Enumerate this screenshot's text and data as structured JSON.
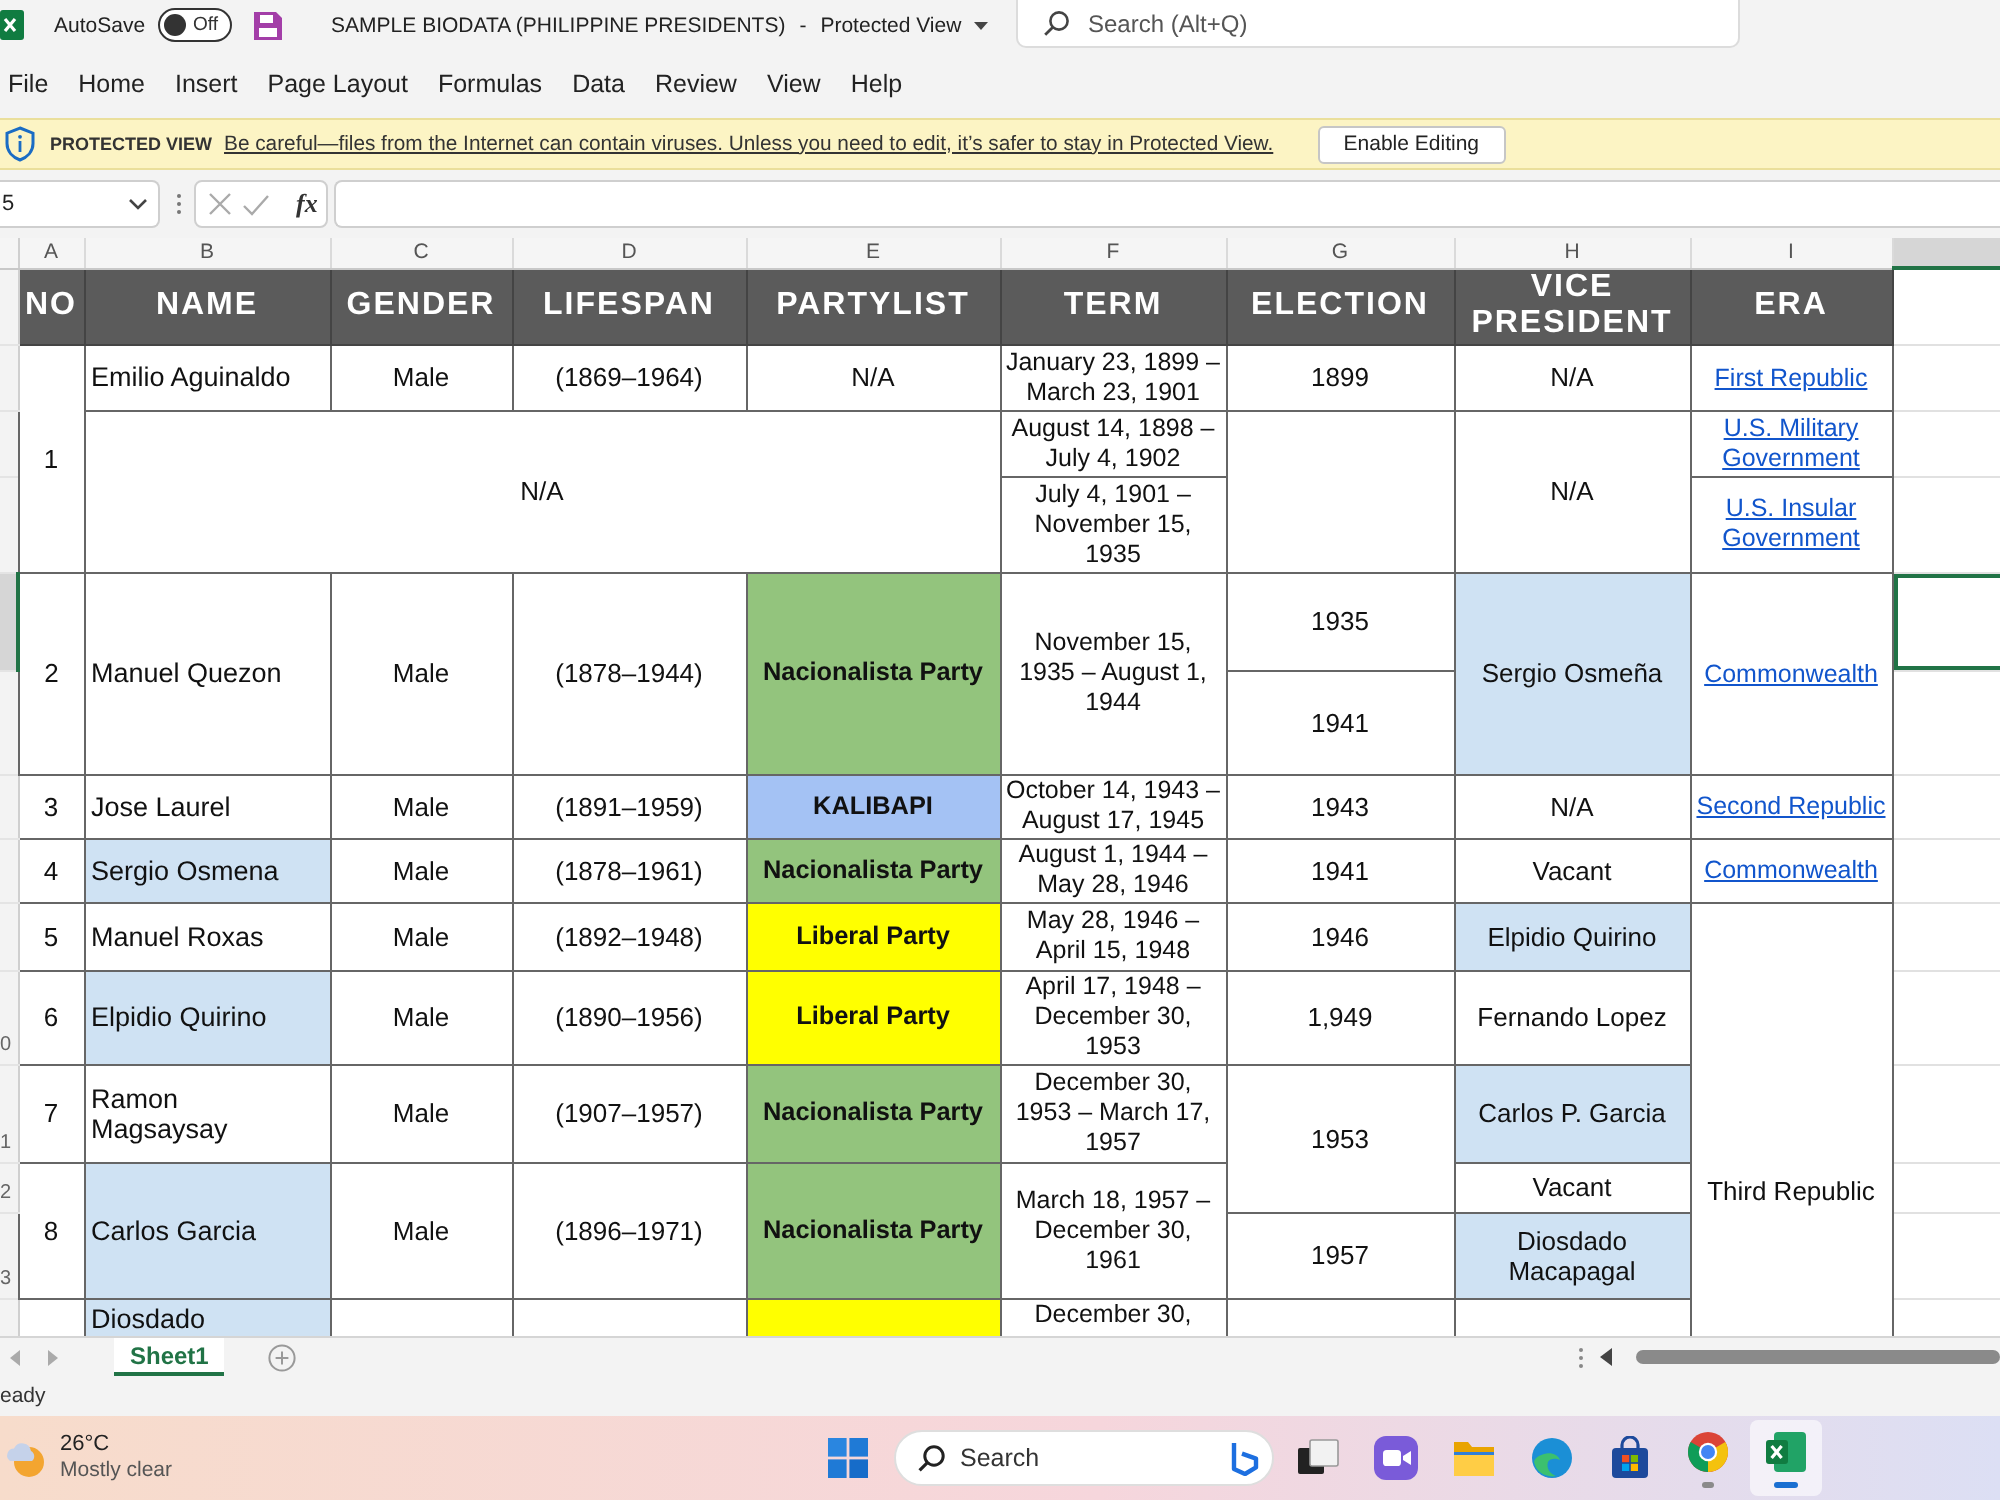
{
  "title_bar": {
    "autosave_label": "AutoSave",
    "autosave": {
      "on": false,
      "label": "Off"
    },
    "document_title": "SAMPLE BIODATA (PHILIPPINE PRESIDENTS)",
    "separator": "-",
    "view_mode": "Protected View",
    "search": {
      "placeholder": "Search (Alt+Q)"
    }
  },
  "menu": [
    {
      "label": "File",
      "selected": false
    },
    {
      "label": "Home",
      "selected": false
    },
    {
      "label": "Insert",
      "selected": false
    },
    {
      "label": "Page Layout",
      "selected": false
    },
    {
      "label": "Formulas",
      "selected": false
    },
    {
      "label": "Data",
      "selected": false
    },
    {
      "label": "Review",
      "selected": false
    },
    {
      "label": "View",
      "selected": false
    },
    {
      "label": "Help",
      "selected": false
    }
  ],
  "protected_view": {
    "title": "PROTECTED VIEW",
    "message": "Be careful—files from the Internet can contain viruses. Unless you need to edit, it’s safer to stay in Protected View.",
    "button": "Enable Editing"
  },
  "formula_bar": {
    "name_box": "5",
    "function_label": "fx"
  },
  "sheet": {
    "column_letters": [
      "A",
      "B",
      "C",
      "D",
      "E",
      "F",
      "G",
      "H",
      "I"
    ],
    "headers": [
      "NO",
      "NAME",
      "GENDER",
      "LIFESPAN",
      "PARTYLIST",
      "TERM",
      "ELECTION",
      "VICE PRESIDENT",
      "ERA"
    ],
    "rows": [
      {
        "selected": false,
        "cells": [
          {
            "kind": "text",
            "text": "1",
            "rowspan": 3
          },
          {
            "kind": "name",
            "text": "Emilio Aguinaldo"
          },
          {
            "kind": "text",
            "text": "Male"
          },
          {
            "kind": "text",
            "text": "(1869–1964)"
          },
          {
            "kind": "text",
            "text": "N/A"
          },
          {
            "kind": "term",
            "text": "January 23, 1899 – March 23, 1901"
          },
          {
            "kind": "text",
            "text": "1899"
          },
          {
            "kind": "text",
            "text": "N/A"
          },
          {
            "kind": "link",
            "text": "First Republic"
          }
        ]
      },
      {
        "selected": false,
        "cells": [
          {
            "kind": "text",
            "text": "N/A",
            "colspan": 4,
            "rowspan": 2
          },
          {
            "kind": "term",
            "text": "August 14, 1898 – July 4, 1902"
          },
          {
            "kind": "text",
            "rowspan": 2
          },
          {
            "kind": "text",
            "text": "N/A",
            "rowspan": 2
          },
          {
            "kind": "link",
            "text": "U.S. Military Government"
          }
        ]
      },
      {
        "selected": false,
        "cells": [
          {
            "kind": "term",
            "text": "July 4, 1901 – November 15, 1935"
          },
          {
            "kind": "link",
            "text": "U.S. Insular Government"
          }
        ]
      },
      {
        "selected": true,
        "cells": [
          {
            "kind": "text",
            "text": "2",
            "rowspan": 2
          },
          {
            "kind": "name",
            "text": "Manuel Quezon",
            "rowspan": 2
          },
          {
            "kind": "text",
            "text": "Male",
            "rowspan": 2
          },
          {
            "kind": "text",
            "text": "(1878–1944)",
            "rowspan": 2
          },
          {
            "kind": "party",
            "text": "Nacionalista Party",
            "color": "#93c47d",
            "rowspan": 2
          },
          {
            "kind": "term",
            "text": "November 15, 1935 – August 1, 1944",
            "rowspan": 2
          },
          {
            "kind": "text",
            "text": "1935"
          },
          {
            "kind": "text",
            "text": "Sergio Osmeña",
            "color": "#cfe2f3",
            "rowspan": 2
          },
          {
            "kind": "link",
            "text": "Commonwealth",
            "rowspan": 2
          }
        ]
      },
      {
        "selected": false,
        "cells": [
          {
            "kind": "text",
            "text": "1941"
          }
        ]
      },
      {
        "selected": false,
        "cells": [
          {
            "kind": "text",
            "text": "3"
          },
          {
            "kind": "name",
            "text": "Jose Laurel"
          },
          {
            "kind": "text",
            "text": "Male"
          },
          {
            "kind": "text",
            "text": "(1891–1959)"
          },
          {
            "kind": "party",
            "text": "KALIBAPI",
            "color": "#a4c2f4"
          },
          {
            "kind": "term",
            "text": "October 14, 1943 – August 17, 1945"
          },
          {
            "kind": "text",
            "text": "1943"
          },
          {
            "kind": "text",
            "text": "N/A"
          },
          {
            "kind": "link",
            "text": "Second Republic"
          }
        ]
      },
      {
        "selected": false,
        "cells": [
          {
            "kind": "text",
            "text": "4"
          },
          {
            "kind": "name",
            "text": "Sergio Osmena",
            "color": "#cfe2f3"
          },
          {
            "kind": "text",
            "text": "Male"
          },
          {
            "kind": "text",
            "text": "(1878–1961)"
          },
          {
            "kind": "party",
            "text": "Nacionalista Party",
            "color": "#93c47d"
          },
          {
            "kind": "term",
            "text": "August 1, 1944 – May 28, 1946"
          },
          {
            "kind": "text",
            "text": "1941"
          },
          {
            "kind": "text",
            "text": "Vacant"
          },
          {
            "kind": "link",
            "text": "Commonwealth"
          }
        ]
      },
      {
        "selected": false,
        "cells": [
          {
            "kind": "text",
            "text": "5"
          },
          {
            "kind": "name",
            "text": "Manuel Roxas"
          },
          {
            "kind": "text",
            "text": "Male"
          },
          {
            "kind": "text",
            "text": "(1892–1948)"
          },
          {
            "kind": "party",
            "text": "Liberal Party",
            "color": "#ffff00"
          },
          {
            "kind": "term",
            "text": "May 28, 1946 – April 15, 1948"
          },
          {
            "kind": "text",
            "text": "1946"
          },
          {
            "kind": "text",
            "text": "Elpidio Quirino",
            "color": "#cfe2f3"
          },
          {
            "kind": "text",
            "text": "Third Republic",
            "rowspan": 6
          }
        ]
      },
      {
        "header": "0",
        "selected": false,
        "cells": [
          {
            "kind": "text",
            "text": "6"
          },
          {
            "kind": "name",
            "text": "Elpidio Quirino",
            "color": "#cfe2f3"
          },
          {
            "kind": "text",
            "text": "Male"
          },
          {
            "kind": "text",
            "text": "(1890–1956)"
          },
          {
            "kind": "party",
            "text": "Liberal Party",
            "color": "#ffff00"
          },
          {
            "kind": "term",
            "text": "April 17, 1948 – December 30, 1953"
          },
          {
            "kind": "text",
            "text": "1,949"
          },
          {
            "kind": "text",
            "text": "Fernando Lopez"
          }
        ]
      },
      {
        "header": "1",
        "selected": false,
        "cells": [
          {
            "kind": "text",
            "text": "7"
          },
          {
            "kind": "name",
            "text": "Ramon\nMagsaysay"
          },
          {
            "kind": "text",
            "text": "Male"
          },
          {
            "kind": "text",
            "text": "(1907–1957)"
          },
          {
            "kind": "party",
            "text": "Nacionalista Party",
            "color": "#93c47d"
          },
          {
            "kind": "term",
            "text": "December 30, 1953 – March 17, 1957"
          },
          {
            "kind": "text",
            "text": "1953",
            "rowspan": 2
          },
          {
            "kind": "text",
            "text": "Carlos P. Garcia",
            "color": "#cfe2f3"
          }
        ]
      },
      {
        "header": "2",
        "selected": false,
        "cells": [
          {
            "kind": "text",
            "text": "8",
            "rowspan": 2
          },
          {
            "kind": "name",
            "text": "Carlos Garcia",
            "color": "#cfe2f3",
            "rowspan": 2
          },
          {
            "kind": "text",
            "text": "Male",
            "rowspan": 2
          },
          {
            "kind": "text",
            "text": "(1896–1971)",
            "rowspan": 2
          },
          {
            "kind": "party",
            "text": "Nacionalista Party",
            "color": "#93c47d",
            "rowspan": 2
          },
          {
            "kind": "term",
            "text": "March 18, 1957 – December 30, 1961",
            "rowspan": 2
          },
          {
            "kind": "text",
            "text": "Vacant"
          }
        ]
      },
      {
        "header": "3",
        "selected": false,
        "cells": [
          {
            "kind": "text",
            "text": "1957"
          },
          {
            "kind": "text",
            "text": "Diosdado Macapagal",
            "color": "#cfe2f3"
          }
        ]
      },
      {
        "selected": false,
        "cells": [
          {
            "kind": "text"
          },
          {
            "kind": "name",
            "text": "Diosdado",
            "color": "#cfe2f3"
          },
          {
            "kind": "text"
          },
          {
            "kind": "text"
          },
          {
            "kind": "party",
            "color": "#ffff00"
          },
          {
            "kind": "term",
            "text": "December 30,"
          },
          {
            "kind": "text"
          },
          {
            "kind": "text"
          }
        ]
      }
    ]
  },
  "sheet_tabs": [
    {
      "label": "Sheet1",
      "selected": true
    }
  ],
  "status_bar": {
    "text": "eady"
  },
  "taskbar": {
    "weather": {
      "temperature": "26°C",
      "condition": "Mostly clear"
    },
    "search": {
      "placeholder": "Search"
    },
    "apps": [
      {
        "kind": "task-view",
        "running": false,
        "selected": false
      },
      {
        "kind": "chat",
        "running": false,
        "selected": false
      },
      {
        "kind": "explorer",
        "running": false,
        "selected": false
      },
      {
        "kind": "edge",
        "running": false,
        "selected": false
      },
      {
        "kind": "store",
        "running": false,
        "selected": false
      },
      {
        "kind": "chrome",
        "running": true,
        "selected": false
      },
      {
        "kind": "excel",
        "running": true,
        "selected": true
      }
    ]
  }
}
